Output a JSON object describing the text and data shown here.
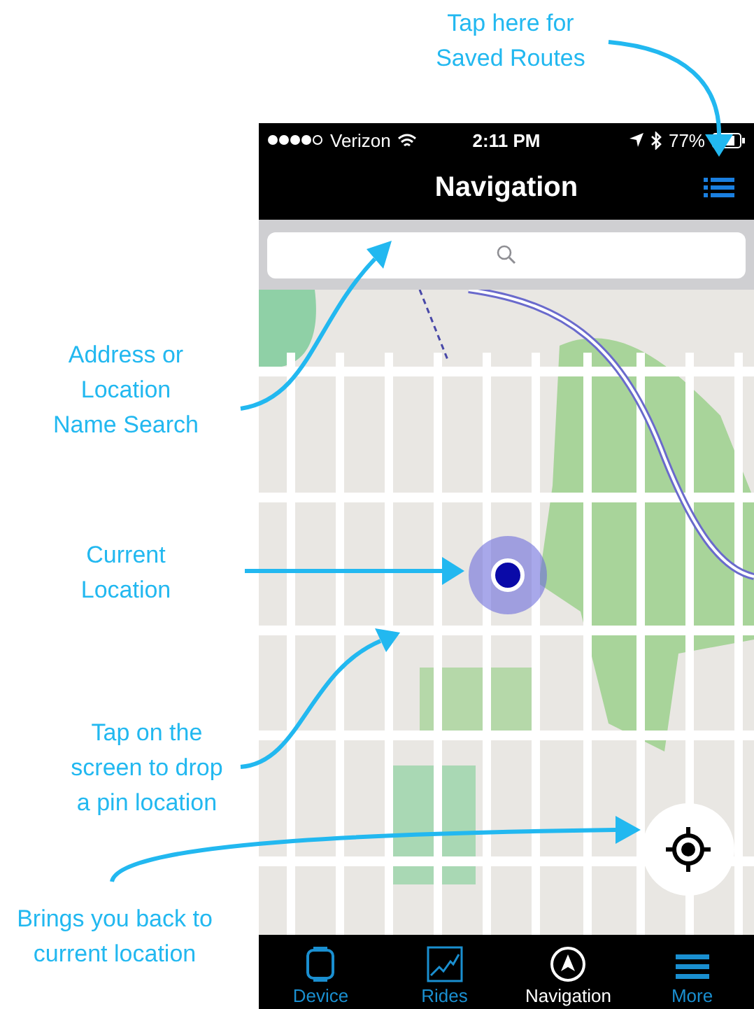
{
  "annotations": [
    {
      "text": "Tap here for\nSaved Routes"
    },
    {
      "text": "Address or\nLocation\nName Search"
    },
    {
      "text": "Current\nLocation"
    },
    {
      "text": "Tap on the\nscreen to drop\na pin location"
    },
    {
      "text": "Brings you back to\ncurrent location"
    }
  ],
  "status_bar": {
    "carrier": "Verizon",
    "time": "2:11 PM",
    "battery": "77%"
  },
  "nav_bar": {
    "title": "Navigation"
  },
  "tabs": [
    {
      "kind": "device",
      "label": "Device",
      "selected": false
    },
    {
      "kind": "rides",
      "label": "Rides",
      "selected": false
    },
    {
      "kind": "navigation",
      "label": "Navigation",
      "selected": true
    },
    {
      "kind": "more",
      "label": "More",
      "selected": false
    }
  ]
}
